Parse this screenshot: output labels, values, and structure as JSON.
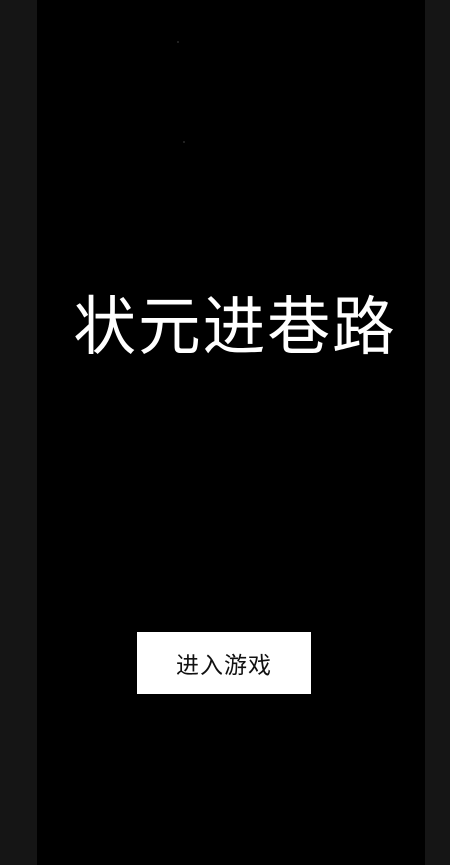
{
  "game": {
    "title": "状元进巷路",
    "enter_button_label": "进入游戏"
  },
  "colors": {
    "background": "#000000",
    "side_bars": "#151515",
    "title_text": "#ffffff",
    "button_bg": "#ffffff",
    "button_text": "#111111"
  }
}
